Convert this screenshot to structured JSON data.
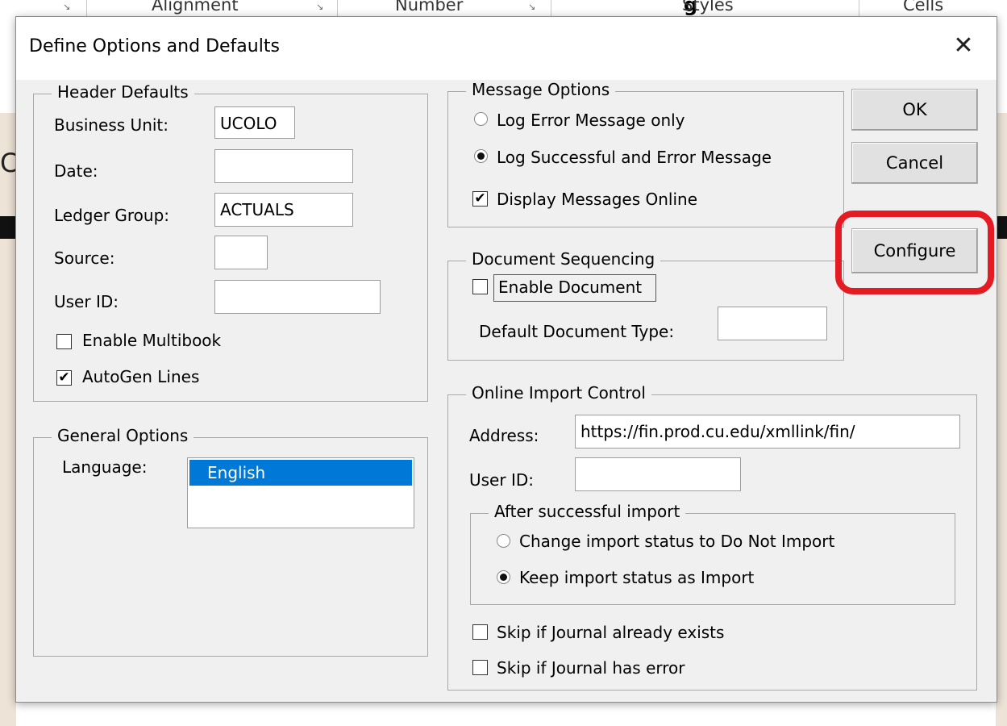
{
  "ribbon": {
    "groups": [
      "Alignment",
      "Number",
      "Styles",
      "Cells"
    ],
    "bold_label": "g"
  },
  "dialog": {
    "title": "Define Options and Defaults",
    "close_glyph": "✕"
  },
  "header_defaults": {
    "legend": "Header Defaults",
    "business_unit_label": "Business Unit:",
    "business_unit_value": "UCOLO",
    "date_label": "Date:",
    "date_value": "",
    "ledger_group_label": "Ledger Group:",
    "ledger_group_value": "ACTUALS",
    "source_label": "Source:",
    "source_value": "",
    "user_id_label": "User ID:",
    "user_id_value": "",
    "enable_multibook_label": "Enable Multibook",
    "enable_multibook_checked": false,
    "autogen_lines_label": "AutoGen Lines",
    "autogen_lines_checked": true
  },
  "general_options": {
    "legend": "General Options",
    "language_label": "Language:",
    "language_selected": "English"
  },
  "message_options": {
    "legend": "Message Options",
    "option1_label": "Log Error Message only",
    "option2_label": "Log Successful and Error Message",
    "selected": "Log Successful and Error Message",
    "display_online_label": "Display Messages Online",
    "display_online_checked": true
  },
  "document_sequencing": {
    "legend": "Document Sequencing",
    "enable_label": "Enable Document",
    "enable_checked": false,
    "default_type_label": "Default Document Type:",
    "default_type_value": ""
  },
  "online_import": {
    "legend": "Online Import Control",
    "address_label": "Address:",
    "address_value": "https://fin.prod.cu.edu/xmllink/fin/",
    "user_id_label": "User ID:",
    "user_id_value": "",
    "after_import_legend": "After successful import",
    "change_status_label": "Change import status to Do Not Import",
    "keep_status_label": "Keep import status as Import",
    "selected": "Keep import status as Import",
    "skip_exists_label": "Skip if Journal already exists",
    "skip_exists_checked": false,
    "skip_error_label": "Skip if Journal has error",
    "skip_error_checked": false
  },
  "buttons": {
    "ok": "OK",
    "cancel": "Cancel",
    "configure": "Configure"
  },
  "colors": {
    "highlight": "#e41b23",
    "selection": "#0078d7",
    "dialog_bg": "#f0f0f0"
  }
}
